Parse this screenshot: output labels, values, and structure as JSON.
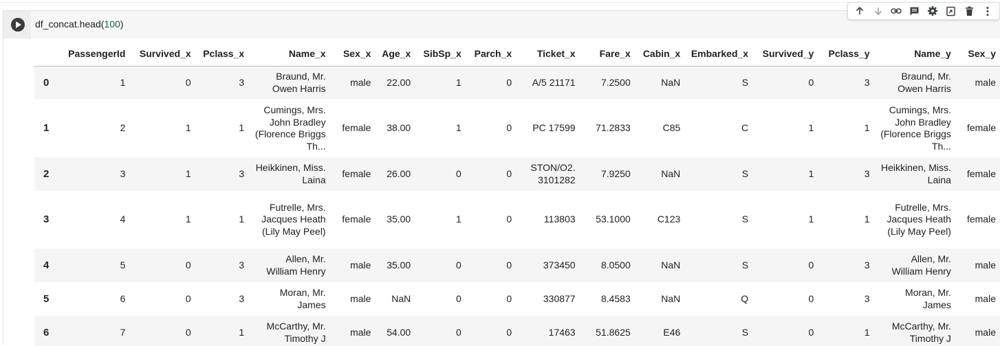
{
  "cell": {
    "code_prefix": "df_concat.head(",
    "code_arg": "100",
    "code_suffix": ")"
  },
  "toolbar": {
    "icons": [
      "arrow-up-icon",
      "arrow-down-icon",
      "link-icon",
      "comment-icon",
      "gear-icon",
      "mirror-cell-icon",
      "trash-icon",
      "more-vert-icon"
    ]
  },
  "table": {
    "columns": [
      "PassengerId",
      "Survived_x",
      "Pclass_x",
      "Name_x",
      "Sex_x",
      "Age_x",
      "SibSp_x",
      "Parch_x",
      "Ticket_x",
      "Fare_x",
      "Cabin_x",
      "Embarked_x",
      "Survived_y",
      "Pclass_y",
      "Name_y",
      "Sex_y"
    ],
    "rows": [
      {
        "index": "0",
        "PassengerId": "1",
        "Survived_x": "0",
        "Pclass_x": "3",
        "Name_x": "Braund, Mr. Owen Harris",
        "Sex_x": "male",
        "Age_x": "22.00",
        "SibSp_x": "1",
        "Parch_x": "0",
        "Ticket_x": "A/5 21171",
        "Fare_x": "7.2500",
        "Cabin_x": "NaN",
        "Embarked_x": "S",
        "Survived_y": "0",
        "Pclass_y": "3",
        "Name_y": "Braund, Mr. Owen Harris",
        "Sex_y": "male"
      },
      {
        "index": "1",
        "PassengerId": "2",
        "Survived_x": "1",
        "Pclass_x": "1",
        "Name_x": "Cumings, Mrs. John Bradley (Florence Briggs Th...",
        "Sex_x": "female",
        "Age_x": "38.00",
        "SibSp_x": "1",
        "Parch_x": "0",
        "Ticket_x": "PC 17599",
        "Fare_x": "71.2833",
        "Cabin_x": "C85",
        "Embarked_x": "C",
        "Survived_y": "1",
        "Pclass_y": "1",
        "Name_y": "Cumings, Mrs. John Bradley (Florence Briggs Th...",
        "Sex_y": "female"
      },
      {
        "index": "2",
        "PassengerId": "3",
        "Survived_x": "1",
        "Pclass_x": "3",
        "Name_x": "Heikkinen, Miss. Laina",
        "Sex_x": "female",
        "Age_x": "26.00",
        "SibSp_x": "0",
        "Parch_x": "0",
        "Ticket_x": "STON/O2. 3101282",
        "Fare_x": "7.9250",
        "Cabin_x": "NaN",
        "Embarked_x": "S",
        "Survived_y": "1",
        "Pclass_y": "3",
        "Name_y": "Heikkinen, Miss. Laina",
        "Sex_y": "female"
      },
      {
        "index": "3",
        "PassengerId": "4",
        "Survived_x": "1",
        "Pclass_x": "1",
        "Name_x": "Futrelle, Mrs. Jacques Heath (Lily May Peel)",
        "Sex_x": "female",
        "Age_x": "35.00",
        "SibSp_x": "1",
        "Parch_x": "0",
        "Ticket_x": "113803",
        "Fare_x": "53.1000",
        "Cabin_x": "C123",
        "Embarked_x": "S",
        "Survived_y": "1",
        "Pclass_y": "1",
        "Name_y": "Futrelle, Mrs. Jacques Heath (Lily May Peel)",
        "Sex_y": "female"
      },
      {
        "index": "4",
        "PassengerId": "5",
        "Survived_x": "0",
        "Pclass_x": "3",
        "Name_x": "Allen, Mr. William Henry",
        "Sex_x": "male",
        "Age_x": "35.00",
        "SibSp_x": "0",
        "Parch_x": "0",
        "Ticket_x": "373450",
        "Fare_x": "8.0500",
        "Cabin_x": "NaN",
        "Embarked_x": "S",
        "Survived_y": "0",
        "Pclass_y": "3",
        "Name_y": "Allen, Mr. William Henry",
        "Sex_y": "male"
      },
      {
        "index": "5",
        "PassengerId": "6",
        "Survived_x": "0",
        "Pclass_x": "3",
        "Name_x": "Moran, Mr. James",
        "Sex_x": "male",
        "Age_x": "NaN",
        "SibSp_x": "0",
        "Parch_x": "0",
        "Ticket_x": "330877",
        "Fare_x": "8.4583",
        "Cabin_x": "NaN",
        "Embarked_x": "Q",
        "Survived_y": "0",
        "Pclass_y": "3",
        "Name_y": "Moran, Mr. James",
        "Sex_y": "male"
      },
      {
        "index": "6",
        "PassengerId": "7",
        "Survived_x": "0",
        "Pclass_x": "1",
        "Name_x": "McCarthy, Mr. Timothy J",
        "Sex_x": "male",
        "Age_x": "54.00",
        "SibSp_x": "0",
        "Parch_x": "0",
        "Ticket_x": "17463",
        "Fare_x": "51.8625",
        "Cabin_x": "E46",
        "Embarked_x": "S",
        "Survived_y": "0",
        "Pclass_y": "1",
        "Name_y": "McCarthy, Mr. Timothy J",
        "Sex_y": "male"
      }
    ]
  }
}
